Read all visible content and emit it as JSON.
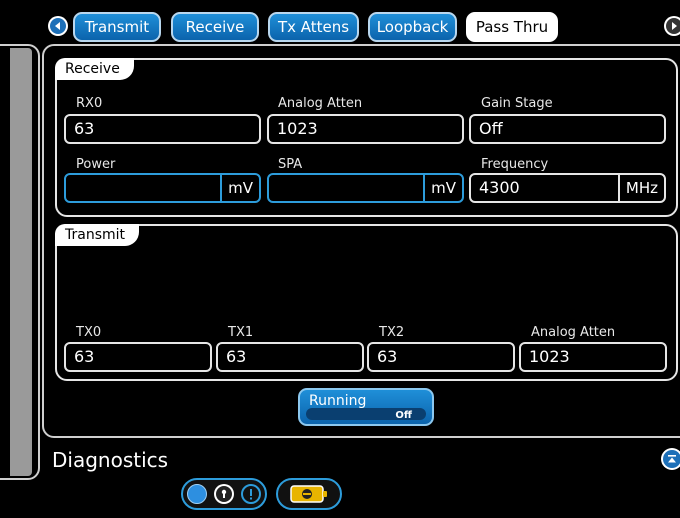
{
  "nav": {
    "tabs": [
      {
        "label": "Transmit",
        "active": false
      },
      {
        "label": "Receive",
        "active": false
      },
      {
        "label": "Tx Attens",
        "active": false
      },
      {
        "label": "Loopback",
        "active": false
      },
      {
        "label": "Pass Thru",
        "active": true
      }
    ],
    "prev_icon": "triangle-left-icon",
    "next_icon": "triangle-right-icon"
  },
  "receive": {
    "title": "Receive",
    "rx0": {
      "label": "RX0",
      "value": "63"
    },
    "analog_atten": {
      "label": "Analog Atten",
      "value": "1023"
    },
    "gain_stage": {
      "label": "Gain Stage",
      "value": "Off"
    },
    "power": {
      "label": "Power",
      "value": "",
      "unit": "mV"
    },
    "spa": {
      "label": "SPA",
      "value": "",
      "unit": "mV"
    },
    "frequency": {
      "label": "Frequency",
      "value": "4300",
      "unit": "MHz"
    }
  },
  "transmit": {
    "title": "Transmit",
    "tx0": {
      "label": "TX0",
      "value": "63"
    },
    "tx1": {
      "label": "TX1",
      "value": "63"
    },
    "tx2": {
      "label": "TX2",
      "value": "63"
    },
    "analog_atten": {
      "label": "Analog Atten",
      "value": "1023"
    }
  },
  "running": {
    "label": "Running",
    "state": "Off"
  },
  "diagnostics": {
    "title": "Diagnostics"
  },
  "colors": {
    "accent": "#1c6fb8",
    "field_border_active": "#2d9cdb",
    "panel_border": "#e6e6e6"
  }
}
